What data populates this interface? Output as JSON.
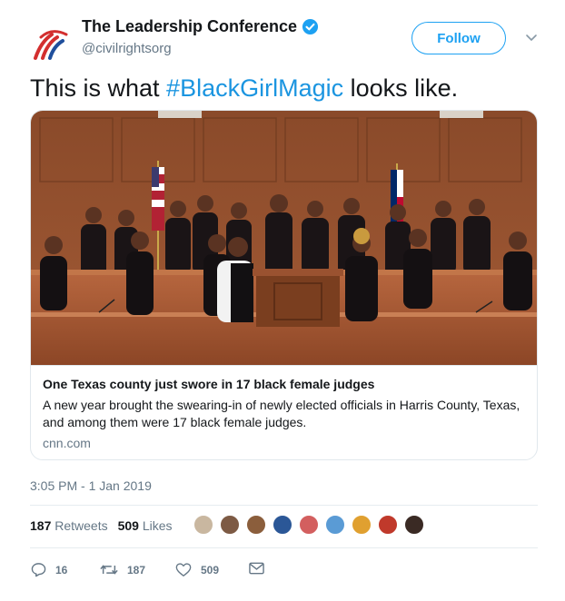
{
  "account": {
    "display_name": "The Leadership Conference",
    "handle": "@civilrightsorg",
    "follow_label": "Follow",
    "brand_colors": [
      "#d32f2f",
      "#1f4f9c"
    ]
  },
  "tweet": {
    "text_before": "This is what ",
    "hashtag": "#BlackGirlMagic",
    "text_after": " looks like."
  },
  "card": {
    "title": "One Texas county just swore in 17 black female judges",
    "description": "A new year brought the swearing-in of newly elected officials in Harris County, Texas, and among them were 17 black female judges.",
    "domain": "cnn.com"
  },
  "meta": {
    "timestamp": "3:05 PM - 1 Jan 2019",
    "retweets_count": "187",
    "retweets_label": "Retweets",
    "likes_count": "509",
    "likes_label": "Likes"
  },
  "actions": {
    "replies": "16",
    "retweets": "187",
    "likes": "509"
  },
  "colors": {
    "accent": "#1da1f2",
    "hashtag": "#1b95e0",
    "secondary_text": "#657786",
    "border": "#e1e8ed"
  }
}
